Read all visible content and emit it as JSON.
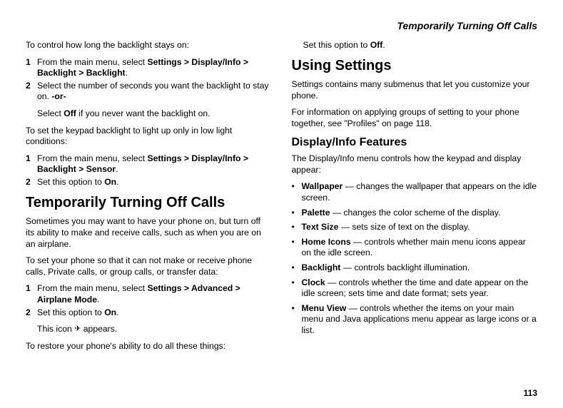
{
  "header": {
    "running_title": "Temporarily Turning Off Calls"
  },
  "left": {
    "p1": "To control how long the backlight stays on:",
    "l1_1a": "From the main menu, select ",
    "l1_1b": "Settings > Display/Info > Backlight > Backlight",
    "l1_1c": ".",
    "l1_2a": "Select the number of seconds you want the backlight to stay on. ",
    "l1_2b": "-or-",
    "l1_2_indent_a": "Select ",
    "l1_2_indent_b": "Off",
    "l1_2_indent_c": " if you never want the backlight on.",
    "p2": "To set the keypad backlight to light up only in low light conditions:",
    "l2_1a": "From the main menu, select ",
    "l2_1b": "Settings > Display/Info > Backlight > Sensor",
    "l2_1c": ".",
    "l2_2a": "Set this option to ",
    "l2_2b": "On",
    "l2_2c": ".",
    "h2": "Temporarily Turning Off Calls",
    "p3": "Sometimes you may want to have your phone on, but turn off its ability to make and receive calls, such as when you are on an airplane.",
    "p4": "To set your phone so that it can not make or receive phone calls, Private calls, or group calls, or transfer data:",
    "l3_1a": "From the main menu, select ",
    "l3_1b": "Settings > Advanced > Airplane Mode",
    "l3_1c": ".",
    "l3_2a": "Set this option to ",
    "l3_2b": "On",
    "l3_2c": ".",
    "l3_2_indent_a": "This icon ",
    "l3_2_indent_b": " appears.",
    "p5": "To restore your phone's ability to do all these things:"
  },
  "right": {
    "p1a": "Set this option to ",
    "p1b": "Off",
    "p1c": ".",
    "h2": "Using Settings",
    "p2": "Settings contains many submenus that let you customize your phone.",
    "p3": "For information on applying groups of setting to your phone together, see \"Profiles\" on page 118.",
    "h3": "Display/Info Features",
    "p4": "The Display/Info menu controls how the keypad and display appear:",
    "b1a": "Wallpaper",
    "b1b": " — changes the wallpaper that appears on the idle screen.",
    "b2a": "Palette",
    "b2b": " — changes the color scheme of the display.",
    "b3a": "Text Size",
    "b3b": " — sets size of text on the display.",
    "b4a": "Home Icons",
    "b4b": " — controls whether main menu icons appear on the idle screen.",
    "b5a": "Backlight",
    "b5b": " — controls backlight illumination.",
    "b6a": "Clock",
    "b6b": " — controls whether the time and date appear on the idle screen; sets time and date format; sets year.",
    "b7a": "Menu View",
    "b7b": " — controls whether the items on your main menu and Java applications menu appear as large icons or a list."
  },
  "footer": {
    "page_number": "113"
  }
}
